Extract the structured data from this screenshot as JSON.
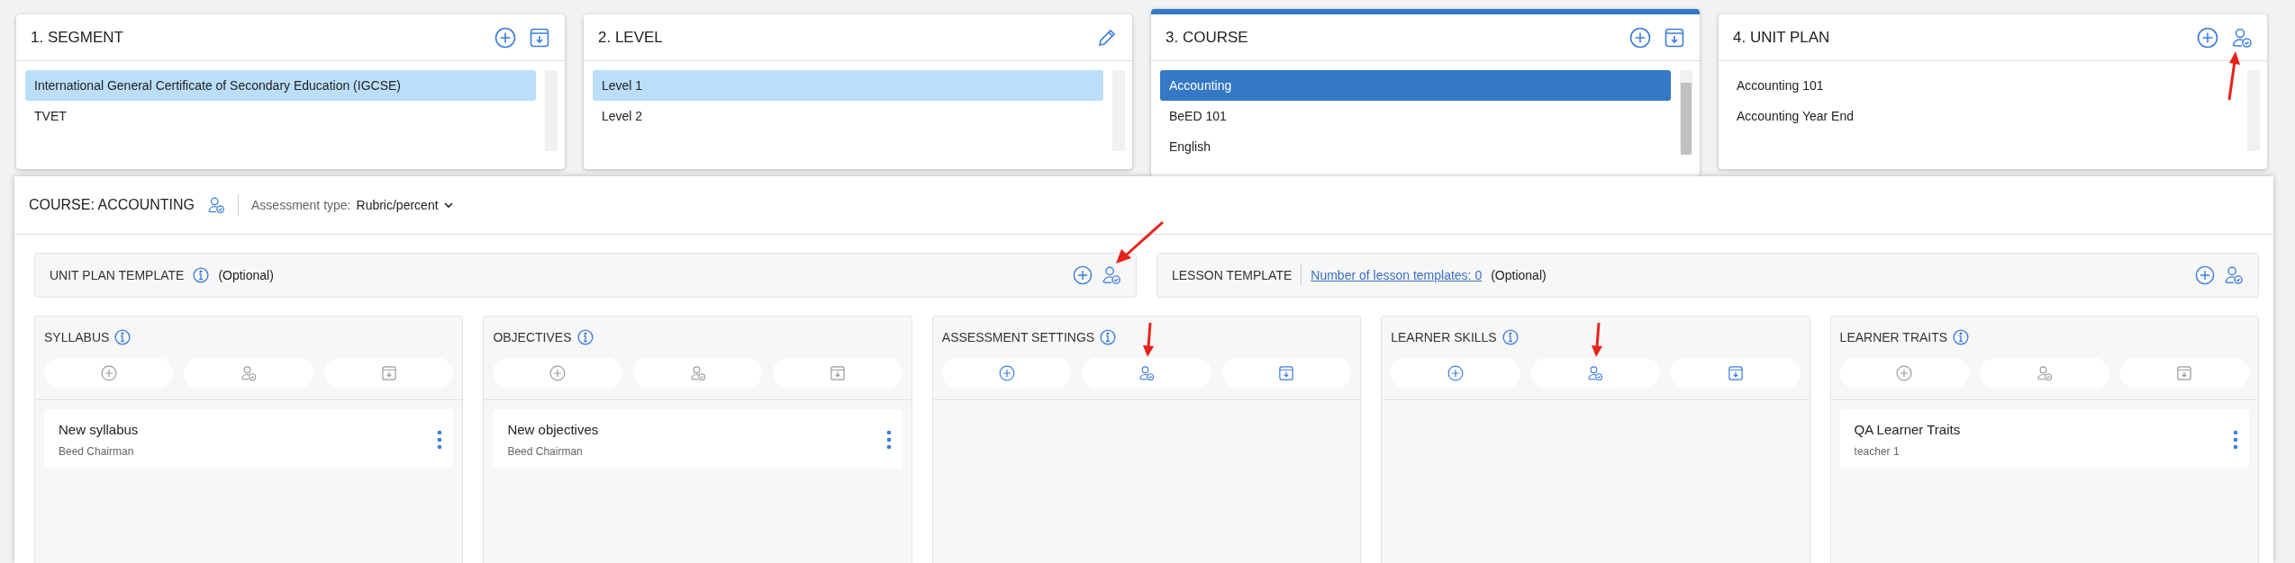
{
  "top_panels": [
    {
      "title": "1. SEGMENT",
      "highlighted": false,
      "actions": [
        {
          "kind": "add"
        },
        {
          "kind": "import"
        }
      ],
      "items": [
        {
          "label": "International General Certificate of Secondary Education (IGCSE)",
          "selected": true
        },
        {
          "label": "TVET",
          "selected": false
        }
      ]
    },
    {
      "title": "2. LEVEL",
      "highlighted": false,
      "actions": [
        {
          "kind": "edit"
        }
      ],
      "items": [
        {
          "label": "Level 1",
          "selected": true
        },
        {
          "label": "Level 2",
          "selected": false
        }
      ]
    },
    {
      "title": "3. COURSE",
      "highlighted": true,
      "actions": [
        {
          "kind": "add"
        },
        {
          "kind": "import"
        }
      ],
      "items": [
        {
          "label": "Accounting",
          "selected": true
        },
        {
          "label": "BeED 101",
          "selected": false
        },
        {
          "label": "English",
          "selected": false
        }
      ]
    },
    {
      "title": "4. UNIT PLAN",
      "highlighted": false,
      "actions": [
        {
          "kind": "add"
        },
        {
          "kind": "assign",
          "annotated": true
        }
      ],
      "items": [
        {
          "label": "Accounting 101",
          "selected": false
        },
        {
          "label": "Accounting Year End",
          "selected": false
        }
      ]
    }
  ],
  "course": {
    "title": "COURSE: ACCOUNTING",
    "assessment_label": "Assessment type:",
    "assessment_value": "Rubric/percent"
  },
  "templates": [
    {
      "title": "UNIT PLAN TEMPLATE",
      "info": true,
      "note": "(Optional)",
      "actions": [
        {
          "kind": "add"
        },
        {
          "kind": "assign",
          "annotated": true
        }
      ]
    },
    {
      "title": "LESSON TEMPLATE",
      "info": false,
      "link": "Number of lesson templates: 0",
      "note": "(Optional)",
      "actions": [
        {
          "kind": "add"
        },
        {
          "kind": "assign"
        }
      ]
    }
  ],
  "columns": [
    {
      "title": "SYLLABUS",
      "enabled": false,
      "buttons": [
        {
          "kind": "add"
        },
        {
          "kind": "assign"
        },
        {
          "kind": "import"
        }
      ],
      "items": [
        {
          "title": "New syllabus",
          "author": "Beed Chairman"
        }
      ]
    },
    {
      "title": "OBJECTIVES",
      "enabled": false,
      "buttons": [
        {
          "kind": "add"
        },
        {
          "kind": "assign"
        },
        {
          "kind": "import"
        }
      ],
      "items": [
        {
          "title": "New objectives",
          "author": "Beed Chairman"
        }
      ]
    },
    {
      "title": "ASSESSMENT SETTINGS",
      "enabled": true,
      "buttons": [
        {
          "kind": "add"
        },
        {
          "kind": "assign",
          "annotated": true
        },
        {
          "kind": "import"
        }
      ]
    },
    {
      "title": "LEARNER SKILLS",
      "enabled": true,
      "buttons": [
        {
          "kind": "add"
        },
        {
          "kind": "assign",
          "annotated": true
        },
        {
          "kind": "import"
        }
      ]
    },
    {
      "title": "LEARNER TRAITS",
      "enabled": false,
      "buttons": [
        {
          "kind": "add"
        },
        {
          "kind": "assign"
        },
        {
          "kind": "import"
        }
      ],
      "items": [
        {
          "title": "QA Learner Traits",
          "author": "teacher 1"
        }
      ]
    }
  ]
}
